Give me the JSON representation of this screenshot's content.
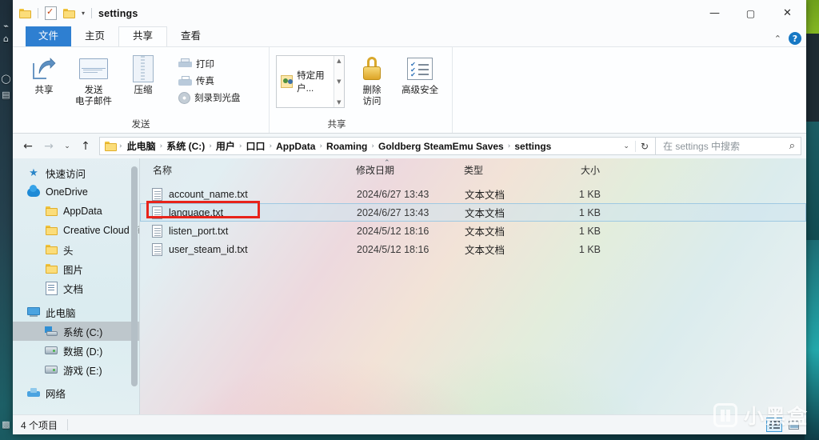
{
  "window": {
    "title": "settings",
    "quick_access": [
      "folder-icon",
      "properties-icon",
      "new-folder-icon",
      "customize-caret"
    ],
    "controls": {
      "minimize": "—",
      "maximize": "☐",
      "close": "✕"
    }
  },
  "ribbon": {
    "tabs": [
      {
        "label": "文件",
        "state": "file"
      },
      {
        "label": "主页",
        "state": "normal"
      },
      {
        "label": "共享",
        "state": "active"
      },
      {
        "label": "查看",
        "state": "normal"
      }
    ],
    "collapse_icon": "⌃",
    "help_label": "?",
    "groups": [
      {
        "title": "发送",
        "big_buttons": [
          {
            "label": "共享",
            "icon": "share-arrow-icon"
          },
          {
            "label": "发送\n电子邮件",
            "line1": "发送",
            "line2": "电子邮件",
            "icon": "mail-icon"
          },
          {
            "label": "压缩",
            "line1": "压缩",
            "line2": "",
            "icon": "zip-icon"
          }
        ],
        "small_buttons": [
          {
            "label": "打印",
            "icon": "printer-icon"
          },
          {
            "label": "传真",
            "icon": "fax-icon"
          },
          {
            "label": "刻录到光盘",
            "icon": "disc-icon"
          }
        ]
      },
      {
        "title": "共享",
        "share_with_list": [
          {
            "label": "特定用户...",
            "icon": "users-icon"
          }
        ],
        "big_buttons": [
          {
            "line1": "删除",
            "line2": "访问",
            "icon": "lock-icon"
          },
          {
            "line1": "高级安全",
            "line2": "",
            "icon": "advanced-security-icon"
          }
        ]
      }
    ]
  },
  "navigation": {
    "back_icon": "←",
    "forward_icon": "→",
    "recent_icon": "⌄",
    "up_icon": "↑",
    "breadcrumbs": [
      "此电脑",
      "系统 (C:)",
      "用户",
      "口口",
      "AppData",
      "Roaming",
      "Goldberg SteamEmu Saves",
      "settings"
    ],
    "separator": "›",
    "dropdown_icon": "⌄",
    "refresh_icon": "↻",
    "search_placeholder": "在 settings 中搜索",
    "search_value": "",
    "search_icon": "⌕"
  },
  "sidebar": {
    "items": [
      {
        "label": "快速访问",
        "icon": "star-icon",
        "level": 0,
        "selected": false
      },
      {
        "label": "OneDrive",
        "icon": "cloud-icon",
        "level": 0,
        "selected": false
      },
      {
        "label": "AppData",
        "icon": "folder-icon",
        "level": 1,
        "selected": false
      },
      {
        "label": "Creative Cloud Fi",
        "icon": "folder-icon",
        "level": 1,
        "selected": false
      },
      {
        "label": "头",
        "icon": "folder-icon",
        "level": 1,
        "selected": false
      },
      {
        "label": "图片",
        "icon": "folder-icon",
        "level": 1,
        "selected": false
      },
      {
        "label": "文档",
        "icon": "documents-icon",
        "level": 1,
        "selected": false
      },
      {
        "label": "此电脑",
        "icon": "this-pc-icon",
        "level": 0,
        "selected": false
      },
      {
        "label": "系统 (C:)",
        "icon": "system-drive-icon",
        "level": 1,
        "selected": true
      },
      {
        "label": "数据 (D:)",
        "icon": "drive-icon",
        "level": 1,
        "selected": false
      },
      {
        "label": "游戏 (E:)",
        "icon": "drive-icon",
        "level": 1,
        "selected": false
      },
      {
        "label": "网络",
        "icon": "network-icon",
        "level": 0,
        "selected": false
      }
    ]
  },
  "filelist": {
    "columns": [
      "名称",
      "修改日期",
      "类型",
      "大小"
    ],
    "sort_indicator": "⌃",
    "rows": [
      {
        "name": "account_name.txt",
        "date": "2024/6/27 13:43",
        "type": "文本文档",
        "size": "1 KB",
        "selected": false,
        "annotated": false
      },
      {
        "name": "language.txt",
        "date": "2024/6/27 13:43",
        "type": "文本文档",
        "size": "1 KB",
        "selected": true,
        "annotated": true
      },
      {
        "name": "listen_port.txt",
        "date": "2024/5/12 18:16",
        "type": "文本文档",
        "size": "1 KB",
        "selected": false,
        "annotated": false
      },
      {
        "name": "user_steam_id.txt",
        "date": "2024/5/12 18:16",
        "type": "文本文档",
        "size": "1 KB",
        "selected": false,
        "annotated": false
      }
    ]
  },
  "statusbar": {
    "item_count": "4 个项目",
    "view_details_icon": "details-view-icon",
    "view_icons_icon": "large-icons-view-icon"
  },
  "watermark": {
    "text": "小黑盒"
  },
  "colors": {
    "accent": "#2e7fd1",
    "annotation": "#e8241b",
    "selection": "#9fc9e2",
    "folder": "#fbdd7a"
  }
}
